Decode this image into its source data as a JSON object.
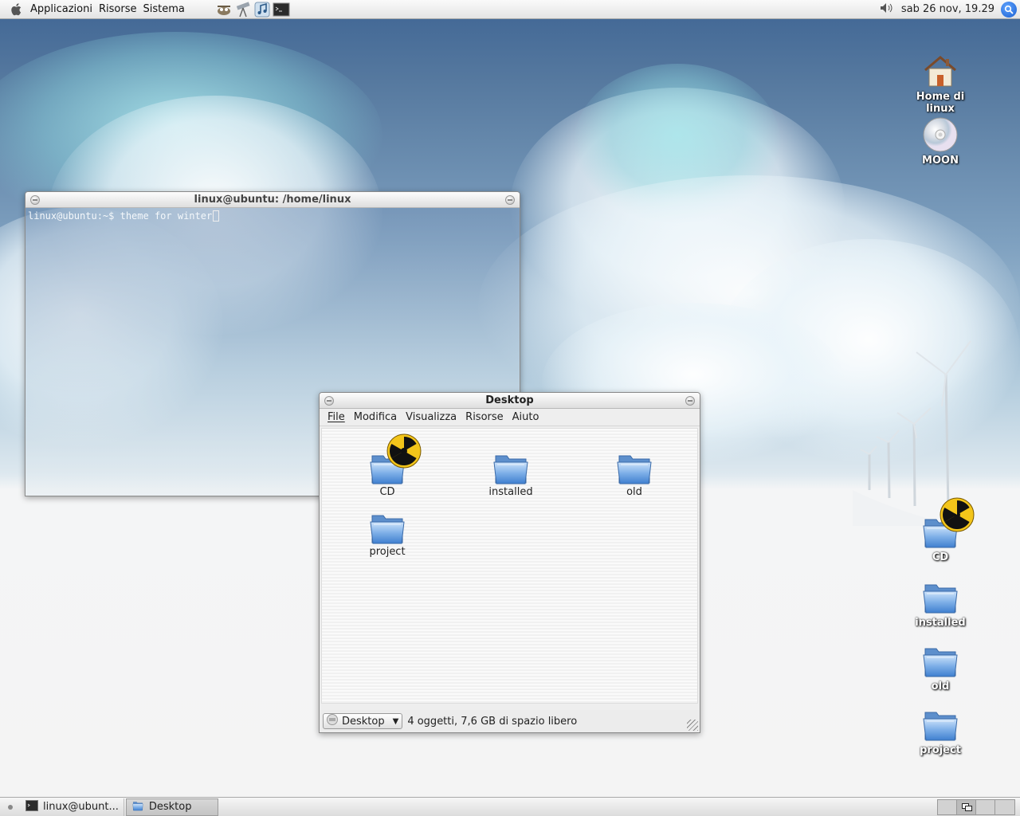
{
  "top_panel": {
    "menus": [
      "Applicazioni",
      "Risorse",
      "Sistema"
    ],
    "clock": "sab 26 nov, 19.29"
  },
  "desktop_icons": [
    {
      "label": "Home di linux",
      "icon": "home-icon"
    },
    {
      "label": "MOON",
      "icon": "cd-disc-icon"
    },
    {
      "label": "CD",
      "icon": "folder-burn-icon"
    },
    {
      "label": "installed",
      "icon": "folder-icon"
    },
    {
      "label": "old",
      "icon": "folder-icon"
    },
    {
      "label": "project",
      "icon": "folder-icon"
    }
  ],
  "terminal": {
    "title": "linux@ubuntu: /home/linux",
    "prompt": "linux@ubuntu:~$ ",
    "command": "theme for winter"
  },
  "file_manager": {
    "title": "Desktop",
    "menu": [
      "File",
      "Modifica",
      "Visualizza",
      "Risorse",
      "Aiuto"
    ],
    "items": [
      {
        "label": "CD",
        "icon": "folder-burn-icon"
      },
      {
        "label": "installed",
        "icon": "folder-icon"
      },
      {
        "label": "old",
        "icon": "folder-icon"
      },
      {
        "label": "project",
        "icon": "folder-icon"
      }
    ],
    "location": "Desktop",
    "status": "4 oggetti, 7,6 GB di spazio libero"
  },
  "taskbar": {
    "tasks": [
      {
        "label": "linux@ubunt...",
        "icon": "terminal-icon"
      },
      {
        "label": "Desktop",
        "icon": "folder-icon",
        "active": true
      }
    ]
  },
  "colors": {
    "folder_blue": "#7fb0e8",
    "sky": "#4a6f9a",
    "panel": "#e8e8e8"
  }
}
